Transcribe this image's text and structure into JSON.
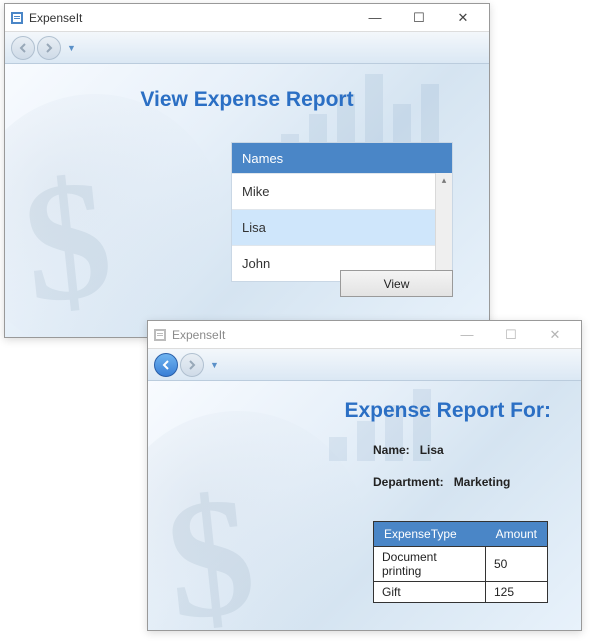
{
  "colors": {
    "accent": "#4a86c7",
    "heading": "#2b6fc4",
    "selection": "#cfe6fb"
  },
  "window1": {
    "title": "ExpenseIt",
    "heading": "View Expense Report",
    "names_header": "Names",
    "names": [
      {
        "label": "Mike",
        "selected": false
      },
      {
        "label": "Lisa",
        "selected": true
      },
      {
        "label": "John",
        "selected": false
      }
    ],
    "view_button": "View",
    "nav_back_enabled": false,
    "nav_fwd_enabled": false
  },
  "window2": {
    "title": "ExpenseIt",
    "heading": "Expense Report For:",
    "name_label": "Name:",
    "name_value": "Lisa",
    "dept_label": "Department:",
    "dept_value": "Marketing",
    "table": {
      "col1": "ExpenseType",
      "col2": "Amount",
      "rows": [
        {
          "type": "Document printing",
          "amount": "50"
        },
        {
          "type": "Gift",
          "amount": "125"
        }
      ]
    },
    "nav_back_enabled": true,
    "nav_fwd_enabled": false
  },
  "sysbuttons": {
    "min": "—",
    "max": "☐",
    "close": "✕"
  }
}
